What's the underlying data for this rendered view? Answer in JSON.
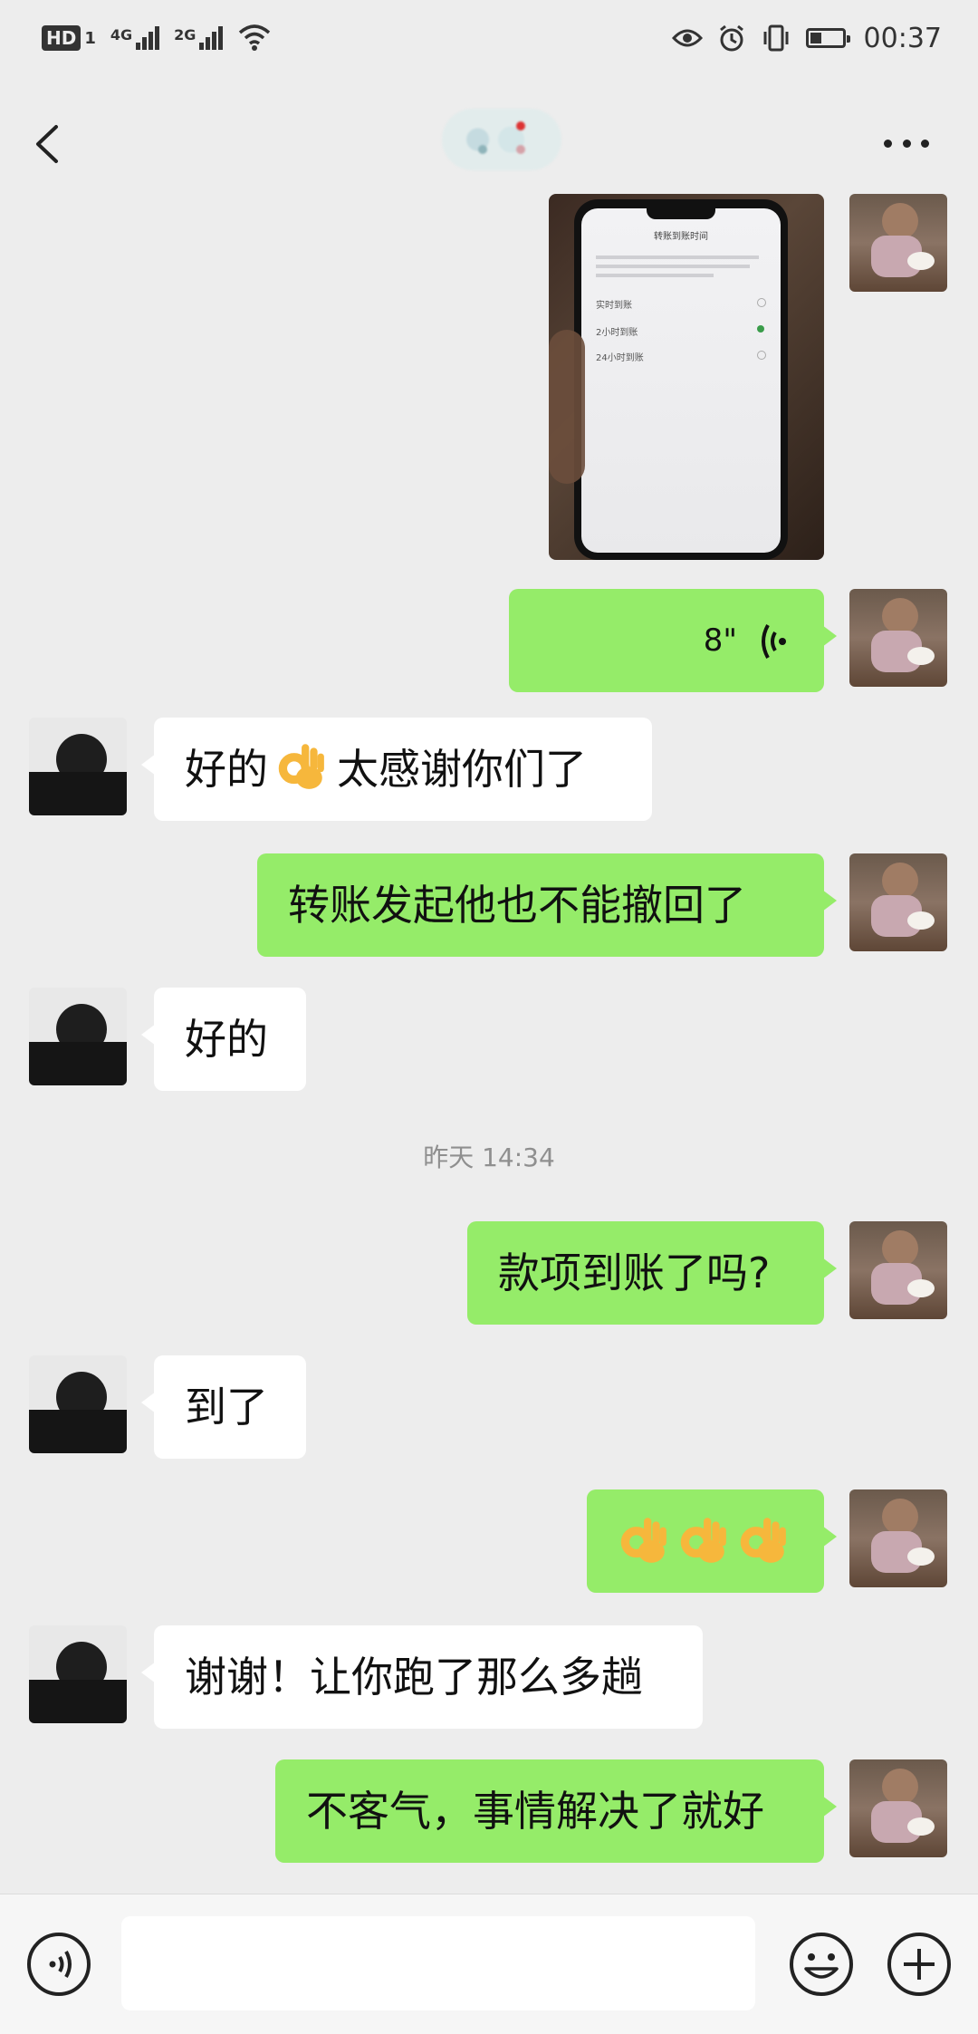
{
  "status_bar": {
    "hd_label": "HD",
    "hd_sub": "1",
    "signal1_label": "4G",
    "signal2_label": "2G",
    "time": "00:37"
  },
  "header": {
    "back_icon": "chevron-left-icon",
    "more_icon": "more-dots-icon"
  },
  "messages": [
    {
      "side": "me",
      "type": "image",
      "image_texts": [
        "转账到账时间",
        "实时到账",
        "2小时到账",
        "24小时到账"
      ]
    },
    {
      "side": "me",
      "type": "voice",
      "duration": "8\""
    },
    {
      "side": "other",
      "type": "text",
      "text_before": "好的",
      "emoji": "ok-hand-emoji",
      "text_after": "太感谢你们了"
    },
    {
      "side": "me",
      "type": "text",
      "text": "转账发起他也不能撤回了"
    },
    {
      "side": "other",
      "type": "text",
      "text": "好的"
    },
    {
      "type": "timestamp",
      "text": "昨天 14:34"
    },
    {
      "side": "me",
      "type": "text",
      "text": "款项到账了吗?"
    },
    {
      "side": "other",
      "type": "text",
      "text": "到了"
    },
    {
      "side": "me",
      "type": "emoji",
      "emoji": "ok-hand-emoji",
      "count": 3
    },
    {
      "side": "other",
      "type": "text",
      "text": "谢谢！让你跑了那么多趟"
    },
    {
      "side": "me",
      "type": "text",
      "text": "不客气，事情解决了就好"
    }
  ],
  "input_bar": {
    "voice_icon": "voice-input-icon",
    "text_value": "",
    "emoji_icon": "smiley-icon",
    "plus_icon": "plus-icon"
  }
}
